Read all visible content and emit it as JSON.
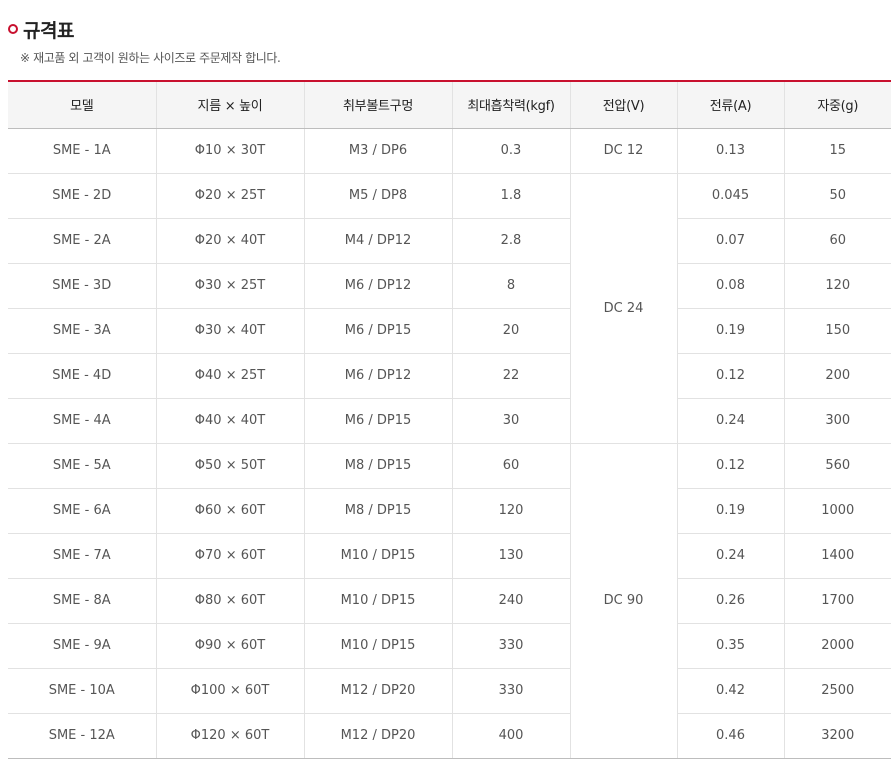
{
  "section": {
    "title": "규격표",
    "note": "※ 재고품 외 고객이 원하는 사이즈로 주문제작 합니다.",
    "accent_color": "#c8102e"
  },
  "table": {
    "headers": [
      "모델",
      "지름 × 높이",
      "취부볼트구멍",
      "최대흡착력(kgf)",
      "전압(V)",
      "전류(A)",
      "자중(g)"
    ],
    "rows": [
      [
        "SME - 1A",
        "Φ10 × 30T",
        "M3 / DP6",
        "0.3",
        "0.13",
        "15"
      ],
      [
        "SME - 2D",
        "Φ20 × 25T",
        "M5 / DP8",
        "1.8",
        "0.045",
        "50"
      ],
      [
        "SME - 2A",
        "Φ20 × 40T",
        "M4 / DP12",
        "2.8",
        "0.07",
        "60"
      ],
      [
        "SME - 3D",
        "Φ30 × 25T",
        "M6 / DP12",
        "8",
        "0.08",
        "120"
      ],
      [
        "SME - 3A",
        "Φ30 × 40T",
        "M6 / DP15",
        "20",
        "0.19",
        "150"
      ],
      [
        "SME - 4D",
        "Φ40 × 25T",
        "M6 / DP12",
        "22",
        "0.12",
        "200"
      ],
      [
        "SME - 4A",
        "Φ40 × 40T",
        "M6 / DP15",
        "30",
        "0.24",
        "300"
      ],
      [
        "SME - 5A",
        "Φ50 × 50T",
        "M8 / DP15",
        "60",
        "0.12",
        "560"
      ],
      [
        "SME - 6A",
        "Φ60 × 60T",
        "M8 / DP15",
        "120",
        "0.19",
        "1000"
      ],
      [
        "SME - 7A",
        "Φ70 × 60T",
        "M10 / DP15",
        "130",
        "0.24",
        "1400"
      ],
      [
        "SME - 8A",
        "Φ80 × 60T",
        "M10 / DP15",
        "240",
        "0.26",
        "1700"
      ],
      [
        "SME - 9A",
        "Φ90 × 60T",
        "M10 / DP15",
        "330",
        "0.35",
        "2000"
      ],
      [
        "SME - 10A",
        "Φ100 × 60T",
        "M12 / DP20",
        "330",
        "0.42",
        "2500"
      ],
      [
        "SME - 12A",
        "Φ120 × 60T",
        "M12 / DP20",
        "400",
        "0.46",
        "3200"
      ]
    ],
    "voltage_groups": [
      {
        "value": "DC 12",
        "rows": 1
      },
      {
        "value": "DC 24",
        "rows": 6
      },
      {
        "value": "DC 90",
        "rows": 7
      }
    ]
  }
}
